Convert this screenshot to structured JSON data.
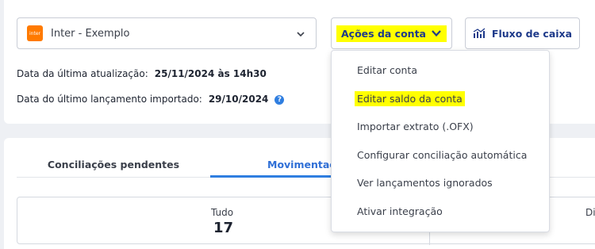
{
  "account": {
    "logo_text": "inter",
    "name": "Inter - Exemplo"
  },
  "toolbar": {
    "acoes_label": "Ações da conta",
    "fluxo_label": "Fluxo de caixa"
  },
  "info": {
    "last_update_label": "Data da última atualização:",
    "last_update_value": "25/11/2024 às 14h30",
    "last_entry_label": "Data do último lançamento importado:",
    "last_entry_value": "29/10/2024"
  },
  "tabs": {
    "pendentes": "Conciliações pendentes",
    "movimentacoes": "Movimentações"
  },
  "summary": {
    "label": "Tudo",
    "value": "17",
    "right_label": "Di"
  },
  "menu": {
    "items": [
      "Editar conta",
      "Editar saldo da conta",
      "Importar extrato (.OFX)",
      "Configurar conciliação automática",
      "Ver lançamentos ignorados",
      "Ativar integração"
    ]
  },
  "colors": {
    "accent": "#2f7ee0",
    "highlight": "#ffff00",
    "logo": "#ff7a00"
  }
}
